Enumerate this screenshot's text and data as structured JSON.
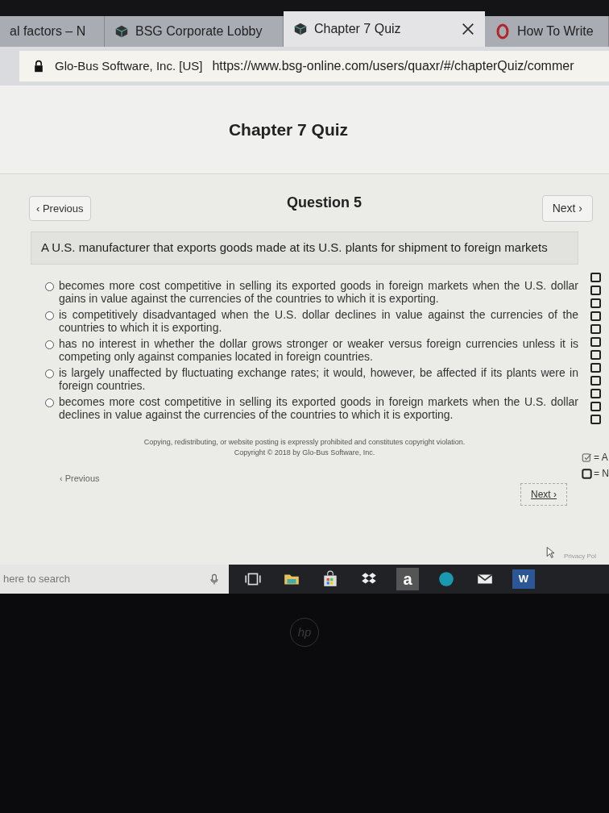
{
  "browser": {
    "tabs": [
      {
        "label": "al factors – N",
        "kind": "plain",
        "selected": false
      },
      {
        "label": "BSG Corporate Lobby",
        "kind": "cube",
        "selected": false
      },
      {
        "label": "Chapter 7 Quiz",
        "kind": "cube",
        "selected": true
      },
      {
        "label": "How To Write",
        "kind": "ring",
        "selected": false
      }
    ],
    "site_name": "Glo-Bus Software, Inc. [US]",
    "url": "https://www.bsg-online.com/users/quaxr/#/chapterQuiz/commer"
  },
  "page": {
    "title": "Chapter 7 Quiz",
    "previous": "‹ Previous",
    "question_title": "Question 5",
    "next": "Next ›",
    "prompt": "A U.S. manufacturer that exports goods made at its U.S. plants for shipment to foreign markets",
    "options": [
      {
        "text": "becomes more cost competitive in selling its exported goods in foreign markets when the U.S. dollar gains in value against the currencies of the countries to which it is exporting.",
        "selected": false
      },
      {
        "text": "is competitively disadvantaged when the U.S. dollar declines in value against the currencies of the countries to which it is exporting.",
        "selected": false
      },
      {
        "text": "has no interest in whether the dollar grows stronger or weaker versus foreign currencies unless it is competing only against companies located in foreign countries.",
        "selected": false
      },
      {
        "text": "is largely unaffected by fluctuating exchange rates; it would, however, be affected if its plants were in foreign countries.",
        "selected": false
      },
      {
        "text": "becomes more cost competitive in selling its exported goods in foreign markets when the U.S. dollar declines in value against the currencies of the countries to which it is exporting.",
        "selected": false
      }
    ],
    "notice": "Copying, redistributing, or website posting is expressly prohibited and constitutes copyright violation.",
    "copyright": "Copyright © 2018 by Glo-Bus Software, Inc.",
    "bottom_previous": "‹ Previous",
    "bottom_next": "Next ›",
    "question_boxes": [
      {
        "answered": false
      },
      {
        "answered": false
      },
      {
        "answered": false
      },
      {
        "answered": false
      },
      {
        "answered": false
      },
      {
        "answered": false
      },
      {
        "answered": false
      },
      {
        "answered": false
      },
      {
        "answered": false
      },
      {
        "answered": false
      },
      {
        "answered": false
      },
      {
        "answered": false
      }
    ],
    "legend": [
      {
        "kind": "answered",
        "label": "= A"
      },
      {
        "kind": "unanswered",
        "label": "= N"
      }
    ],
    "footer_link": "Privacy Pol"
  },
  "taskbar": {
    "search_placeholder": "here to search",
    "apps": [
      {
        "kind": "task-view"
      },
      {
        "kind": "folder"
      },
      {
        "kind": "store"
      },
      {
        "kind": "dropbox"
      },
      {
        "kind": "amazon",
        "label": "a"
      },
      {
        "kind": "edge"
      },
      {
        "kind": "mail"
      },
      {
        "kind": "word",
        "label": "W"
      }
    ]
  },
  "device": {
    "logo": "hp"
  }
}
